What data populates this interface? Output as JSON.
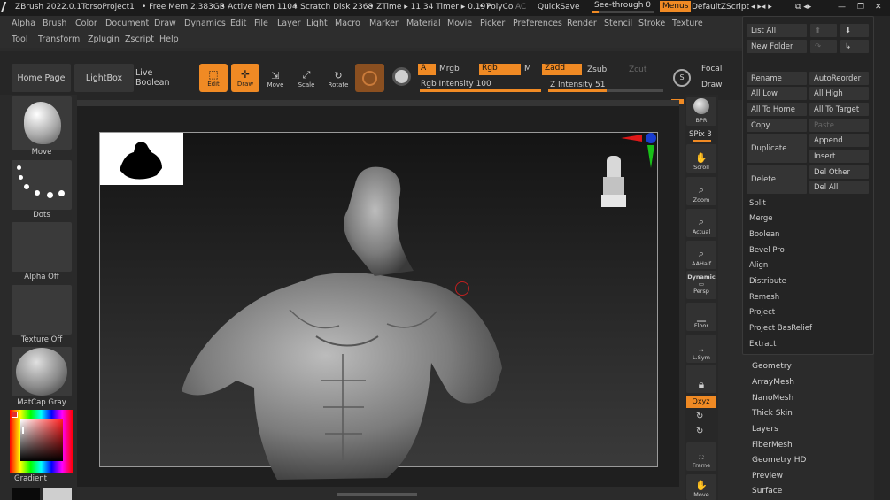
{
  "titlebar": {
    "app": "ZBrush 2022.0.1",
    "project": "TorsoProject1",
    "free_mem": "• Free Mem 2.383GB",
    "active_mem": "• Active Mem 1104",
    "scratch": "• Scratch Disk 2368",
    "ztime": "• ZTime ▸ 11.34 Timer ▸ 0.197",
    "polyco": "• PolyCo",
    "ac": "AC",
    "quicksave": "QuickSave",
    "see_through": "See-through  0",
    "menus": "Menus",
    "zscript": "DefaultZScript"
  },
  "menu_row1": [
    "Alpha",
    "Brush",
    "Color",
    "Document",
    "Draw",
    "Dynamics",
    "Edit",
    "File",
    "Layer",
    "Light",
    "Macro",
    "Marker",
    "Material",
    "Movie",
    "Picker",
    "Preferences",
    "Render",
    "Stencil",
    "Stroke",
    "Texture"
  ],
  "menu_row2": [
    "Tool",
    "Transform",
    "Zplugin",
    "Zscript",
    "Help"
  ],
  "shelf": {
    "home": "Home Page",
    "lightbox": "LightBox",
    "live_boolean": "Live Boolean",
    "edit": "Edit",
    "draw": "Draw",
    "move": "Move",
    "scale": "Scale",
    "rotate": "Rotate",
    "a": "A",
    "mrgb": "Mrgb",
    "rgb": "Rgb",
    "m": "M",
    "zadd": "Zadd",
    "zsub": "Zsub",
    "zcut": "Zcut",
    "rgb_intensity": "Rgb Intensity 100",
    "z_intensity": "Z Intensity 51",
    "focal": "Focal",
    "draw2": "Draw"
  },
  "shelf_levels": {
    "rgb_intensity_pct": 100,
    "z_intensity_pct": 51
  },
  "left_panel": {
    "move": "Move",
    "dots": "Dots",
    "alpha_off": "Alpha Off",
    "texture_off": "Texture Off",
    "matcap": "MatCap Gray",
    "gradient": "Gradient"
  },
  "right_shelf": {
    "bpr": "BPR",
    "spix": "SPix 3",
    "scroll": "Scroll",
    "zoom": "Zoom",
    "actual": "Actual",
    "aahalf": "AAHalf",
    "dynamic": "Dynamic",
    "persp": "Persp",
    "floor": "Floor",
    "lsym": "L.Sym",
    "xyz": "Qxyz",
    "frame": "Frame",
    "move": "Move"
  },
  "subtool": {
    "list_all": "List All",
    "new_folder": "New Folder",
    "rename": "Rename",
    "auto_reorder": "AutoReorder",
    "all_low": "All Low",
    "all_high": "All High",
    "all_to_home": "All To Home",
    "all_to_target": "All To Target",
    "copy": "Copy",
    "paste": "Paste",
    "duplicate": "Duplicate",
    "append": "Append",
    "insert": "Insert",
    "delete": "Delete",
    "del_other": "Del Other",
    "del_all": "Del All",
    "split": "Split",
    "merge": "Merge",
    "boolean": "Boolean",
    "bevel_pro": "Bevel Pro",
    "align": "Align",
    "distribute": "Distribute",
    "remesh": "Remesh",
    "project": "Project",
    "project_bas": "Project BasRelief",
    "extract": "Extract"
  },
  "tool_menu": [
    "Geometry",
    "ArrayMesh",
    "NanoMesh",
    "Thick Skin",
    "Layers",
    "FiberMesh",
    "Geometry HD",
    "Preview",
    "Surface"
  ],
  "colors": {
    "accent": "#f08a24",
    "bg": "#2b2b2b"
  }
}
